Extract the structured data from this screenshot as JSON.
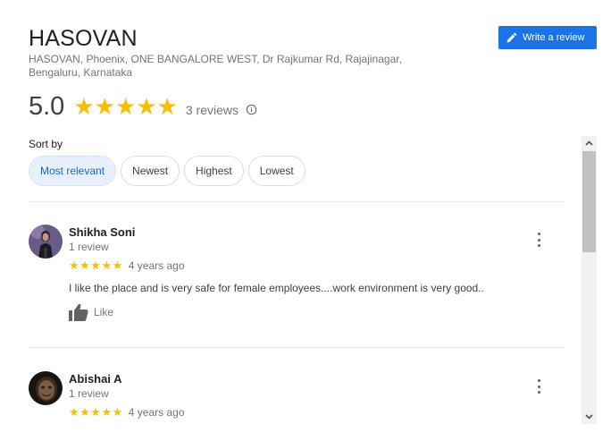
{
  "place": {
    "name": "HASOVAN",
    "address": "HASOVAN, Phoenix, ONE BANGALORE WEST, Dr Rajkumar Rd, Rajajinagar, Bengaluru, Karnataka"
  },
  "write_review": {
    "label": "Write a review",
    "icon": "pencil-icon"
  },
  "rating": {
    "value": "5.0",
    "stars": "★★★★★",
    "count_text": "3 reviews",
    "info_icon": "info-icon"
  },
  "sort": {
    "label": "Sort by",
    "options": [
      "Most relevant",
      "Newest",
      "Highest",
      "Lowest"
    ],
    "selected": "Most relevant"
  },
  "reviews": [
    {
      "name": "Shikha Soni",
      "meta": "1 review",
      "stars": "★★★★★",
      "rating": 5,
      "date": "4 years ago",
      "text": "I like the place and is very safe for female employees....work environment is very good..",
      "like_label": "Like"
    },
    {
      "name": "Abishai A",
      "meta": "1 review",
      "stars": "★★★★★",
      "rating": 5,
      "date": "4 years ago"
    }
  ],
  "colors": {
    "accent": "#1a73e8",
    "star": "#fbbc04",
    "chip_active_bg": "#e8f0fe",
    "chip_active_text": "#1967d2"
  }
}
